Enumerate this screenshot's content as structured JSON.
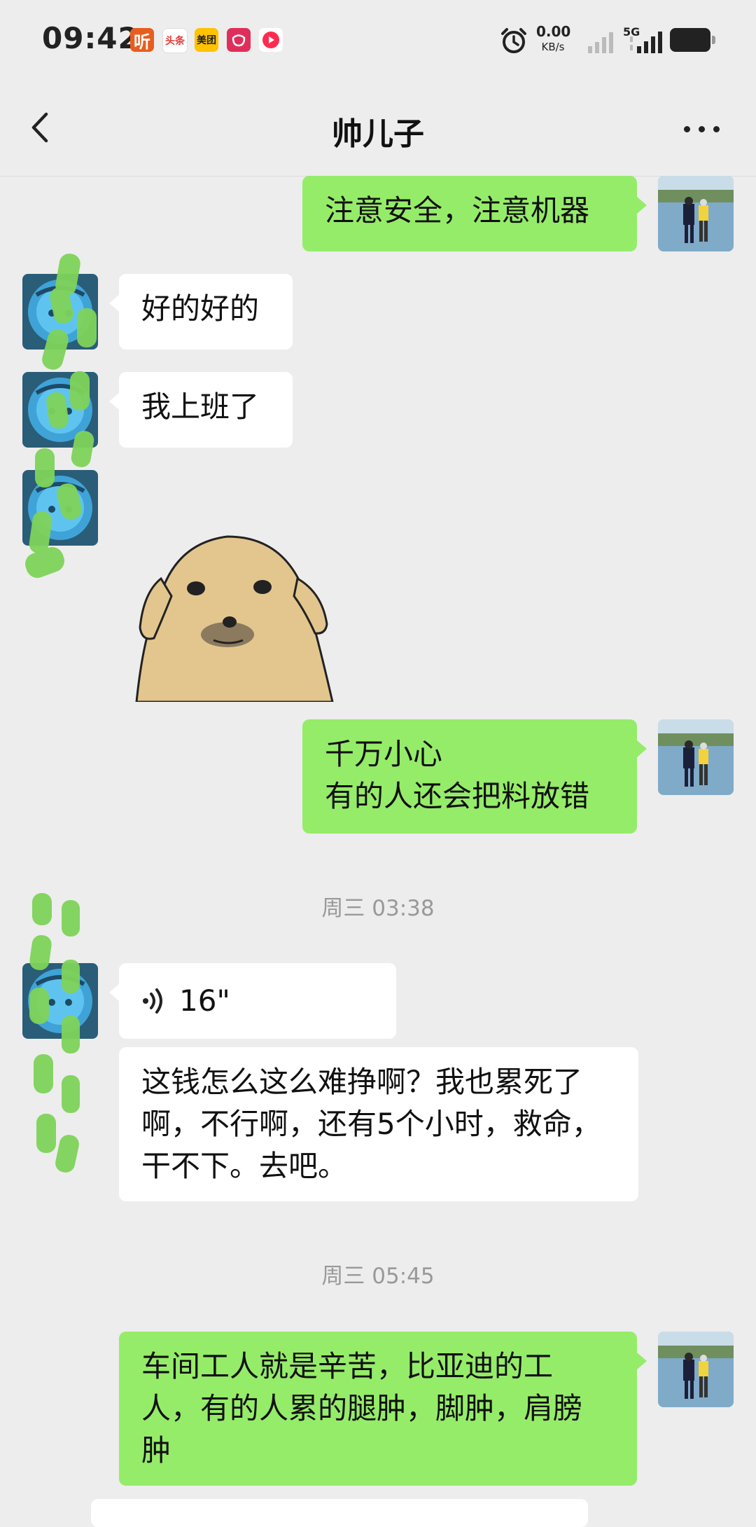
{
  "status_bar": {
    "time": "09:42",
    "apps": [
      {
        "name": "ting-app-icon",
        "text": "听",
        "color": "#e85d1f"
      },
      {
        "name": "toutiao-app-icon",
        "text": "头条",
        "color": "#e53935"
      },
      {
        "name": "meituan-app-icon",
        "text": "美团",
        "color": "#ffc300"
      },
      {
        "name": "pinduoduo-app-icon",
        "text": "",
        "color": "#e02e5a"
      },
      {
        "name": "video-app-icon",
        "text": "",
        "color": "#ff2a4f"
      }
    ],
    "net_speed": "0.00",
    "net_unit": "KB/s",
    "network_label": "5G"
  },
  "header": {
    "title": "帅儿子"
  },
  "messages": [
    {
      "side": "me",
      "text": "注意安全，注意机器"
    },
    {
      "side": "them",
      "text": "好的好的"
    },
    {
      "side": "them",
      "text": "我上班了"
    },
    {
      "side": "them",
      "type": "sticker",
      "sticker": "dog-sticker"
    },
    {
      "side": "me",
      "lines": [
        "千万小心",
        "有的人还会把料放错"
      ]
    },
    {
      "type": "timestamp",
      "text": "周三 03:38"
    },
    {
      "side": "them",
      "type": "voice",
      "duration": "16\""
    },
    {
      "side": "them",
      "lines": [
        "这钱怎么这么难挣啊？我也累死了",
        "啊，不行啊，还有5个小时，救命，",
        "干不下。去吧。"
      ]
    },
    {
      "type": "timestamp",
      "text": "周三 05:45"
    },
    {
      "side": "me",
      "lines": [
        "车间工人就是辛苦，比亚迪的工",
        "人，有的人累的腿肿，脚肿，肩膀",
        "肿"
      ]
    }
  ],
  "colors": {
    "my_bubble": "#95ec69",
    "their_bubble": "#ffffff",
    "background": "#ededed",
    "scribble": "#7fd35a"
  }
}
